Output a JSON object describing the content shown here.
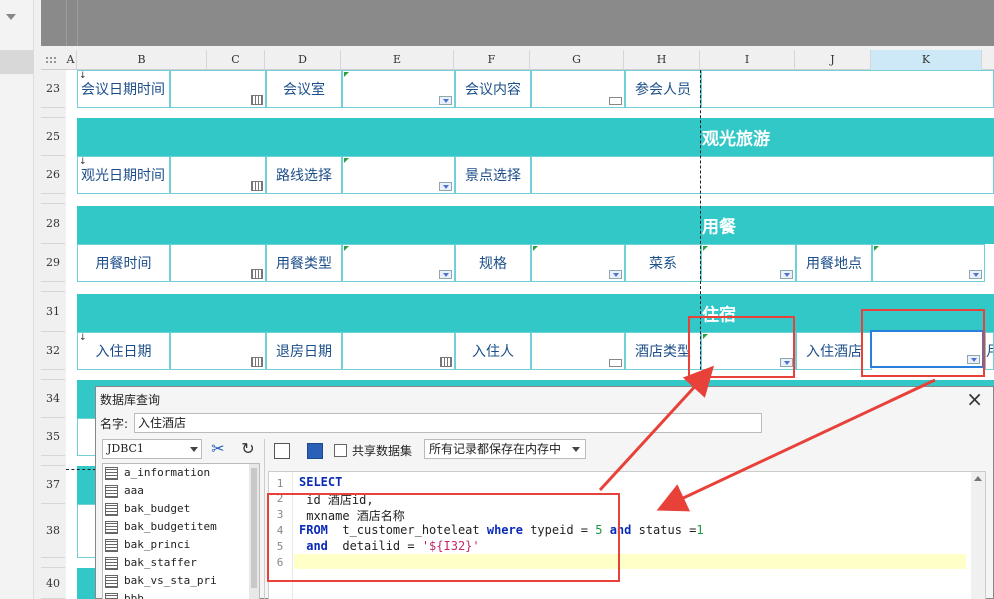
{
  "spreadsheet": {
    "columns": [
      "A",
      "B",
      "C",
      "D",
      "E",
      "F",
      "G",
      "H",
      "I",
      "J",
      "K"
    ],
    "selected_column": "K",
    "rows": {
      "r23": "23",
      "r25": "25",
      "r26": "26",
      "r28": "28",
      "r29": "29",
      "r31": "31",
      "r32": "32",
      "r34": "34",
      "r35": "35",
      "r37": "37",
      "r38": "38",
      "r40": "40"
    },
    "row23": {
      "b": "会议日期时间",
      "d": "会议室",
      "f": "会议内容",
      "h": "参会人员"
    },
    "section_sightseeing": "观光旅游",
    "row26": {
      "b": "观光日期时间",
      "d": "路线选择",
      "f": "景点选择"
    },
    "section_dining": "用餐",
    "row29": {
      "b": "用餐时间",
      "d": "用餐类型",
      "f": "规格",
      "h": "菜系",
      "j": "用餐地点"
    },
    "section_lodging": "住宿",
    "row32": {
      "b": "入住日期",
      "d": "退房日期",
      "f": "入住人",
      "h": "酒店类型",
      "j": "入住酒店",
      "l": "月"
    }
  },
  "dialog": {
    "title": "数据库查询",
    "name_label": "名字:",
    "name_value": "入住酒店",
    "datasource": "JDBC1",
    "share_dataset_label": "共享数据集",
    "memory_option": "所有记录都保存在内存中",
    "tables": [
      "a_information",
      "aaa",
      "bak_budget",
      "bak_budgetitem",
      "bak_princi",
      "bak_staffer",
      "bak_vs_sta_pri",
      "bbb"
    ],
    "line_numbers": [
      "1",
      "2",
      "3",
      "4",
      "5",
      "6"
    ],
    "sql": {
      "l1_kw": "SELECT",
      "l2": " id 酒店id,",
      "l3": " mxname 酒店名称",
      "l4_kw1": "FROM",
      "l4_table": "  t_customer_hoteleat ",
      "l4_kw2": "where",
      "l4_col1": " typeid = ",
      "l4_num1": "5",
      "l4_kw3": " and",
      "l4_col2": " status =",
      "l4_num2": "1",
      "l5_kw": " and",
      "l5_col": "  detailid = ",
      "l5_str": "'${I32}'"
    }
  },
  "colors": {
    "teal": "#33c8c8",
    "annotation_red": "#e8413a",
    "selection_blue": "#2b7fdc"
  }
}
